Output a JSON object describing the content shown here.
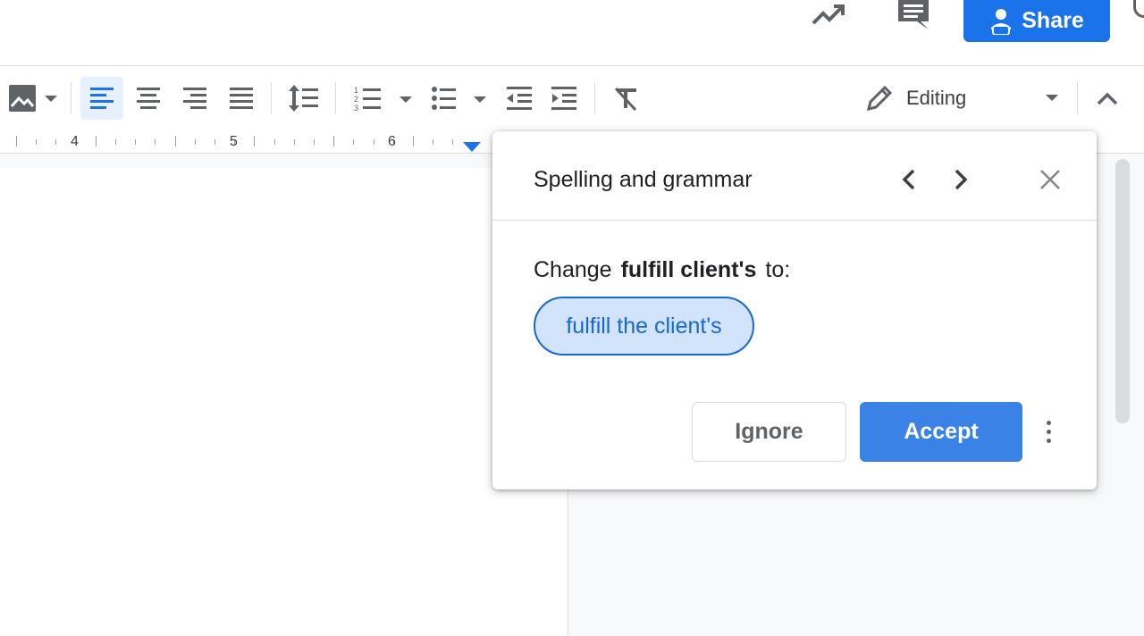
{
  "header": {
    "share_label": "Share"
  },
  "toolbar": {
    "mode_label": "Editing"
  },
  "ruler": {
    "numbers": [
      "4",
      "5",
      "6"
    ]
  },
  "dialog": {
    "title": "Spelling and grammar",
    "change_prefix": "Change",
    "change_word": "fulfill client's",
    "change_suffix": "to:",
    "suggestion": "fulfill the client's",
    "ignore_label": "Ignore",
    "accept_label": "Accept"
  },
  "colors": {
    "accent": "#1a73e8",
    "accept_button": "#3b82e6",
    "suggestion_bg": "#d2e3fc",
    "suggestion_text": "#1967d2",
    "active_tool_bg": "#e8f0fe"
  },
  "icons": [
    "trending-up-icon",
    "comment-icon",
    "share-lock-icon",
    "image-icon",
    "align-left-icon",
    "align-center-icon",
    "align-right-icon",
    "justify-icon",
    "line-spacing-icon",
    "numbered-list-icon",
    "bulleted-list-icon",
    "decrease-indent-icon",
    "increase-indent-icon",
    "clear-formatting-icon",
    "pencil-icon",
    "chevron-up-icon",
    "chevron-left-icon",
    "chevron-right-icon",
    "close-icon",
    "more-vert-icon"
  ]
}
